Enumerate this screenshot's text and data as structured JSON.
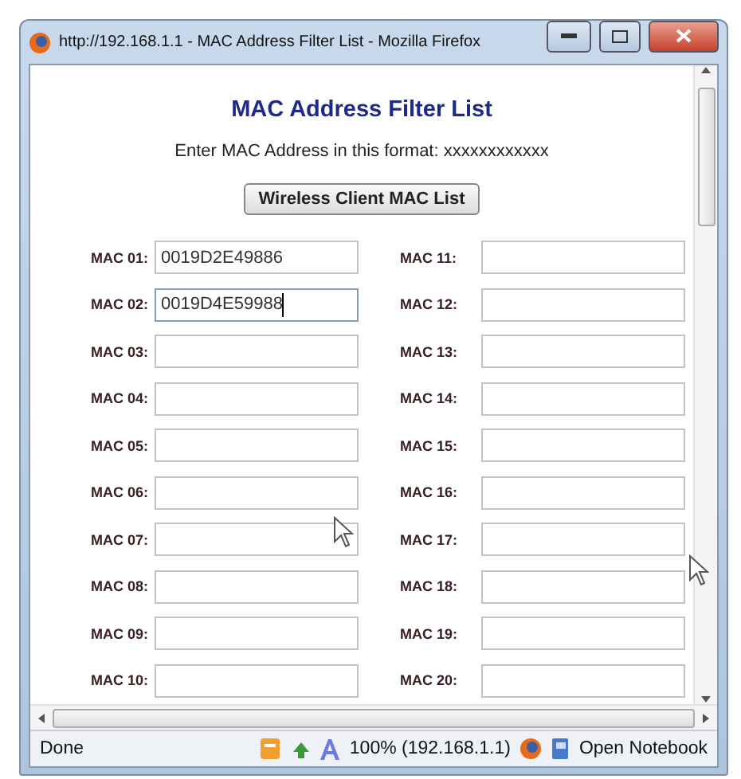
{
  "window": {
    "title": "http://192.168.1.1 - MAC Address Filter List - Mozilla Firefox"
  },
  "heading": "MAC Address Filter List",
  "instruction": "Enter MAC Address in this format: xxxxxxxxxxxx",
  "button": "Wireless Client MAC List",
  "fields": [
    {
      "label": "MAC 01:",
      "value": "0019D2E49886",
      "focused": false
    },
    {
      "label": "MAC 02:",
      "value": "0019D4E59988",
      "focused": true
    },
    {
      "label": "MAC 03:",
      "focused": false
    },
    {
      "label": "MAC 04:",
      "focused": false
    },
    {
      "label": "MAC 05:",
      "focused": false
    },
    {
      "label": "MAC 06:",
      "focused": false
    },
    {
      "label": "MAC 07:",
      "focused": false
    },
    {
      "label": "MAC 08:",
      "focused": false
    },
    {
      "label": "MAC 09:",
      "focused": false
    },
    {
      "label": "MAC 10:",
      "focused": false
    },
    {
      "label": "MAC 11:",
      "focused": false
    },
    {
      "label": "MAC 12:",
      "focused": false
    },
    {
      "label": "MAC 13:",
      "focused": false
    },
    {
      "label": "MAC 14:",
      "focused": false
    },
    {
      "label": "MAC 15:",
      "focused": false
    },
    {
      "label": "MAC 16:",
      "focused": false
    },
    {
      "label": "MAC 17:",
      "focused": false
    },
    {
      "label": "MAC 18:",
      "focused": false
    },
    {
      "label": "MAC 19:",
      "focused": false
    },
    {
      "label": "MAC 20:",
      "focused": false
    }
  ],
  "status_bar": {
    "status": "Done",
    "zoom": "100% (192.168.1.1)",
    "notebook": "Open Notebook"
  }
}
